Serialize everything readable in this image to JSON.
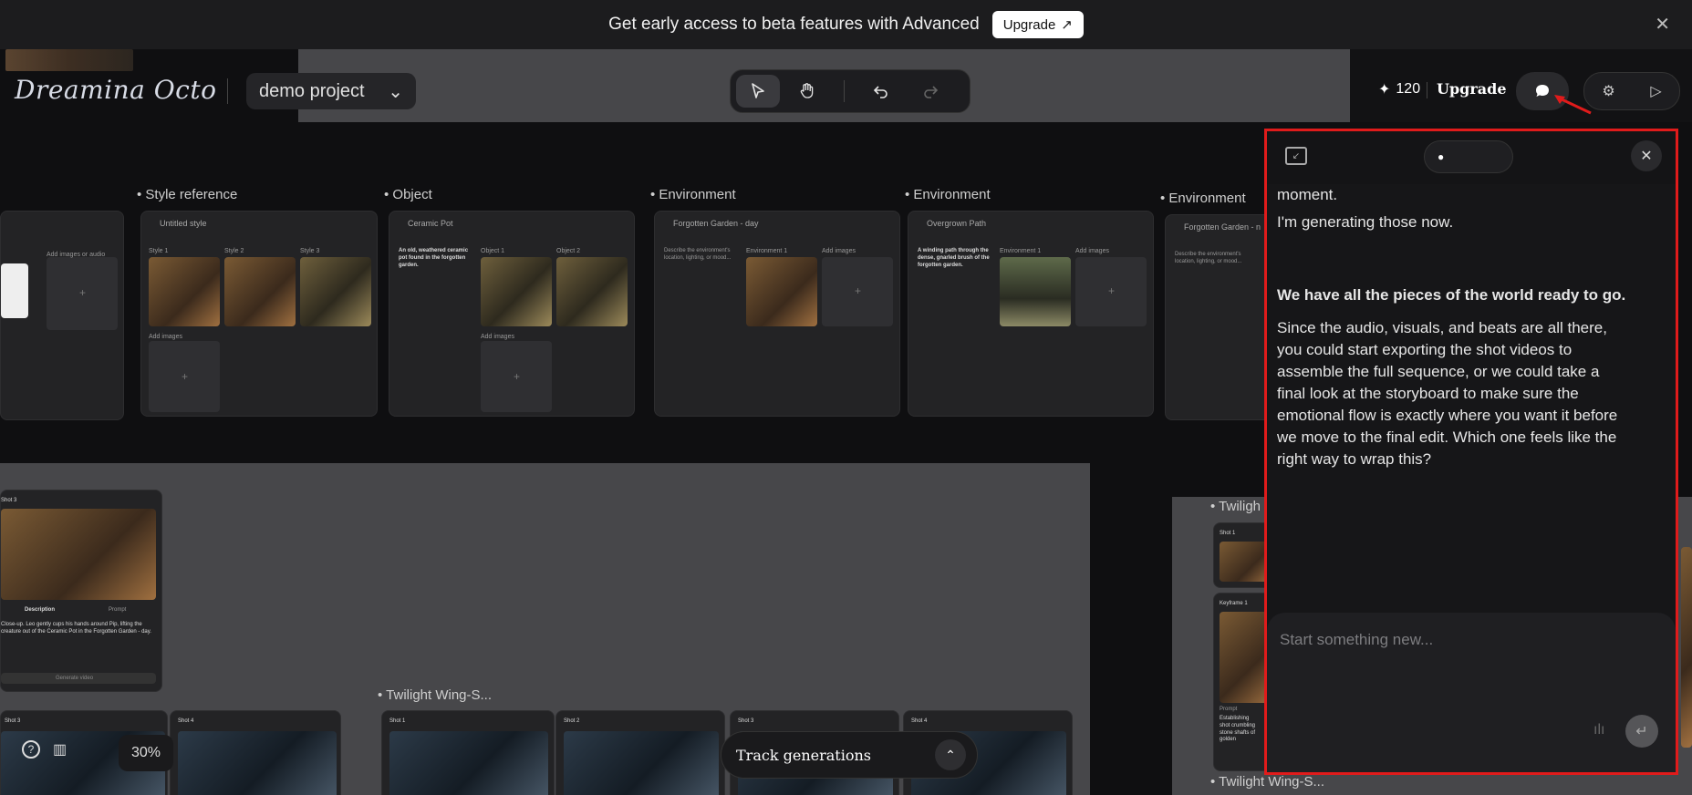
{
  "banner": {
    "text": "Get early access to beta features with Advanced",
    "upgrade_label": "Upgrade",
    "upgrade_icon": "arrow-up-right-icon",
    "close_icon": "close-icon"
  },
  "header": {
    "logo": "Dreamina Octo",
    "project_name": "demo project",
    "credits": "120",
    "upgrade_label": "Upgrade"
  },
  "toolbar": {
    "tools": [
      "select-cursor-icon",
      "hand-pan-icon",
      "undo-icon",
      "redo-icon"
    ]
  },
  "canvas": {
    "sections": [
      {
        "label": "Style reference",
        "card_title": "Untitled style",
        "slots": [
          "Style 1",
          "Style 2",
          "Style 3"
        ],
        "add_label": "Add images"
      },
      {
        "label": "Object",
        "card_title": "Ceramic Pot",
        "description": "An old, weathered ceramic pot found in the forgotten garden.",
        "slots": [
          "Object 1",
          "Object 2"
        ],
        "add_label": "Add images"
      },
      {
        "label": "Environment",
        "card_title": "Forgotten Garden - day",
        "description": "Describe the environment's location, lighting, or mood...",
        "slots": [
          "Environment 1"
        ],
        "add_label": "Add images"
      },
      {
        "label": "Environment",
        "card_title": "Overgrown Path",
        "description": "A winding path through the dense, gnarled brush of the forgotten garden.",
        "slots": [
          "Environment 1"
        ],
        "add_label": "Add images"
      },
      {
        "label": "Environment",
        "card_title": "Forgotten Garden - n",
        "description": "Describe the environment's location, lighting, or mood..."
      }
    ],
    "left_card": {
      "add_label": "Add images or audio"
    },
    "shot_card": {
      "title": "Shot 3",
      "tabs": [
        "Description",
        "Prompt"
      ],
      "description": "Close-up. Leo gently cups his hands around Pip, lifting the creature out of the Ceramic Pot in the Forgotten Garden - day.",
      "button": "Generate video"
    },
    "sequence_label": "Twilight Wing-S...",
    "sequence_label_right": "Twiligh",
    "sequence_label_bottom": "Twilight Wing-S...",
    "bottom_shots": [
      "Shot 1",
      "Shot 2",
      "Shot 3",
      "Shot 4"
    ],
    "left_shots": [
      "Shot 3",
      "Shot 4"
    ],
    "right_card": {
      "shot": "Shot 1",
      "keyframe": "Keyframe 1",
      "prompt_label": "Prompt",
      "text": "Establishing shot crumbling stone shafts of golden"
    }
  },
  "chat": {
    "pill_label": "●",
    "messages": [
      "moment.",
      "I'm generating those now.",
      "We have all the pieces of the world ready to go.",
      "Since the audio, visuals, and beats are all there, you could start exporting the shot videos to assemble the full sequence, or we could take a final look at the storyboard to make sure the emotional flow is exactly where you want it before we move to the final edit. Which one feels like the right way to wrap this?"
    ],
    "input_placeholder": "Start something new..."
  },
  "bottom": {
    "zoom": "30%",
    "track_label": "Track generations"
  },
  "colors": {
    "highlight": "#e01b1b",
    "canvas_bg": "#0f0f11",
    "grey_area": "#47474a"
  }
}
